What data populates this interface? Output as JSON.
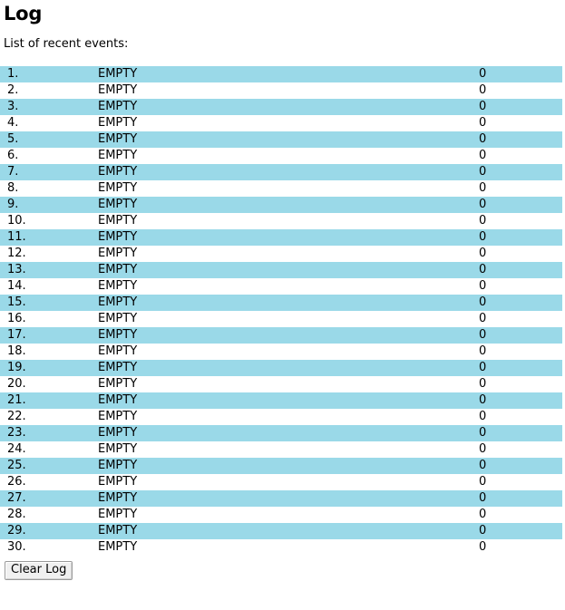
{
  "page": {
    "title": "Log",
    "subtitle": "List of recent events:"
  },
  "table": {
    "rows": [
      {
        "index": "1.",
        "message": "EMPTY",
        "value": "0"
      },
      {
        "index": "2.",
        "message": "EMPTY",
        "value": "0"
      },
      {
        "index": "3.",
        "message": "EMPTY",
        "value": "0"
      },
      {
        "index": "4.",
        "message": "EMPTY",
        "value": "0"
      },
      {
        "index": "5.",
        "message": "EMPTY",
        "value": "0"
      },
      {
        "index": "6.",
        "message": "EMPTY",
        "value": "0"
      },
      {
        "index": "7.",
        "message": "EMPTY",
        "value": "0"
      },
      {
        "index": "8.",
        "message": "EMPTY",
        "value": "0"
      },
      {
        "index": "9.",
        "message": "EMPTY",
        "value": "0"
      },
      {
        "index": "10.",
        "message": "EMPTY",
        "value": "0"
      },
      {
        "index": "11.",
        "message": "EMPTY",
        "value": "0"
      },
      {
        "index": "12.",
        "message": "EMPTY",
        "value": "0"
      },
      {
        "index": "13.",
        "message": "EMPTY",
        "value": "0"
      },
      {
        "index": "14.",
        "message": "EMPTY",
        "value": "0"
      },
      {
        "index": "15.",
        "message": "EMPTY",
        "value": "0"
      },
      {
        "index": "16.",
        "message": "EMPTY",
        "value": "0"
      },
      {
        "index": "17.",
        "message": "EMPTY",
        "value": "0"
      },
      {
        "index": "18.",
        "message": "EMPTY",
        "value": "0"
      },
      {
        "index": "19.",
        "message": "EMPTY",
        "value": "0"
      },
      {
        "index": "20.",
        "message": "EMPTY",
        "value": "0"
      },
      {
        "index": "21.",
        "message": "EMPTY",
        "value": "0"
      },
      {
        "index": "22.",
        "message": "EMPTY",
        "value": "0"
      },
      {
        "index": "23.",
        "message": "EMPTY",
        "value": "0"
      },
      {
        "index": "24.",
        "message": "EMPTY",
        "value": "0"
      },
      {
        "index": "25.",
        "message": "EMPTY",
        "value": "0"
      },
      {
        "index": "26.",
        "message": "EMPTY",
        "value": "0"
      },
      {
        "index": "27.",
        "message": "EMPTY",
        "value": "0"
      },
      {
        "index": "28.",
        "message": "EMPTY",
        "value": "0"
      },
      {
        "index": "29.",
        "message": "EMPTY",
        "value": "0"
      },
      {
        "index": "30.",
        "message": "EMPTY",
        "value": "0"
      }
    ]
  },
  "actions": {
    "clear_log_label": "Clear Log"
  },
  "colors": {
    "row_highlight": "#9ad9e8",
    "row_default": "#ffffff",
    "text": "#000000",
    "button_face": "#f0f0f0",
    "button_border": "#9a9a9a"
  }
}
